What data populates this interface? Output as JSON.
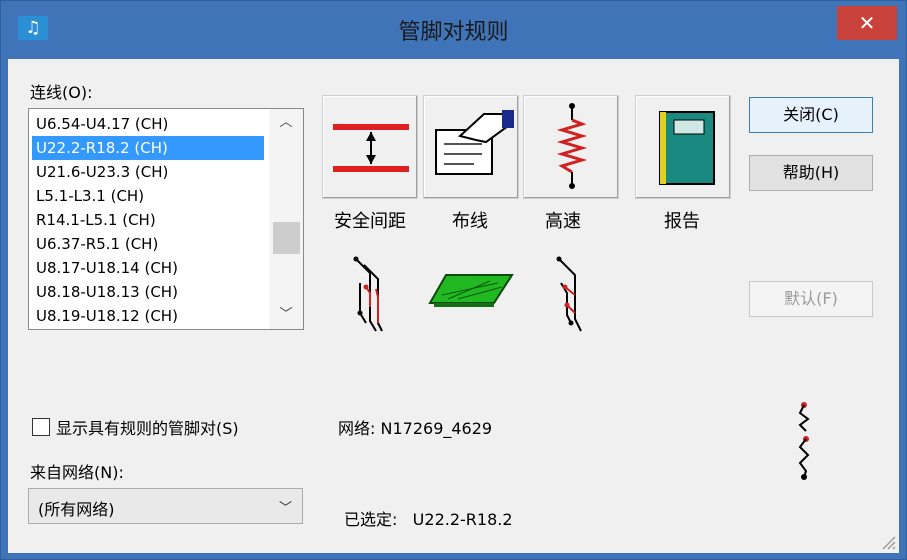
{
  "window": {
    "title": "管脚对规则",
    "app_icon": "music-note-icon",
    "close_glyph": "✕"
  },
  "connections": {
    "label": "连线(O):",
    "items": [
      "U6.54-U4.17  (CH)",
      "U22.2-R18.2  (CH)",
      "U21.6-U23.3  (CH)",
      "L5.1-L3.1  (CH)",
      "R14.1-L5.1  (CH)",
      "U6.37-R5.1  (CH)",
      "U8.17-U18.14  (CH)",
      "U8.18-U18.13  (CH)",
      "U8.19-U18.12  (CH)"
    ],
    "selected_index": 1,
    "scroll_up": "︿",
    "scroll_down": "﹀"
  },
  "rule_buttons": [
    {
      "label": "安全间距",
      "icon": "clearance-icon"
    },
    {
      "label": "布线",
      "icon": "routing-hand-icon"
    },
    {
      "label": "高速",
      "icon": "high-speed-icon"
    },
    {
      "label": "报告",
      "icon": "report-book-icon"
    }
  ],
  "small_icons": [
    "differential-pair-icon",
    "pcb-board-icon",
    "matched-length-icon",
    "pin-pair-chain-icon"
  ],
  "buttons": {
    "close": "关闭(C)",
    "help": "帮助(H)",
    "default": "默认(F)"
  },
  "show_rules_checkbox": {
    "label": "显示具有规则的管脚对(S)",
    "checked": false
  },
  "net": {
    "label": "网络:",
    "value": "N17269_4629"
  },
  "from_net": {
    "label": "来自网络(N):",
    "value": "(所有网络)",
    "arrow": "﹀"
  },
  "selected": {
    "label": "已选定:",
    "value": "U22.2-R18.2"
  },
  "colors": {
    "titlebar": "#3f74b8",
    "close": "#c8423b",
    "selection": "#3399ff",
    "dialog_bg": "#f0f0f0"
  }
}
